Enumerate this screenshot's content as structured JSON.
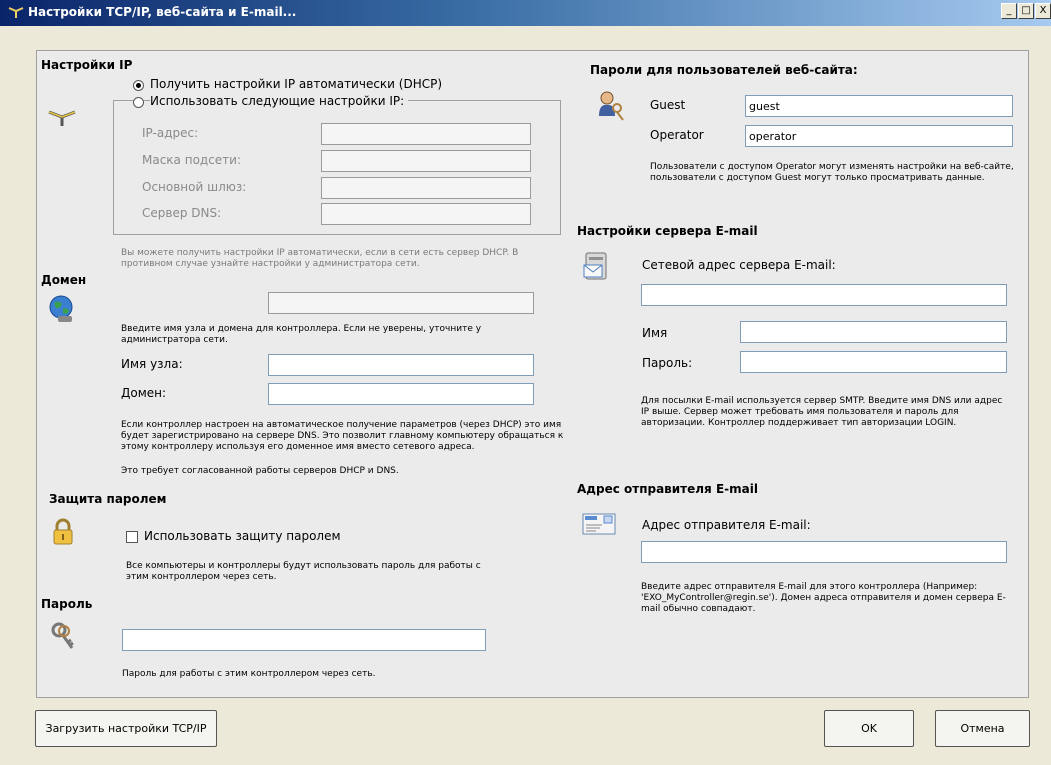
{
  "window": {
    "title": "Настройки TCP/IP, веб-сайта и E-mail...",
    "minimize": "_",
    "maximize": "□",
    "close": "X"
  },
  "ip": {
    "heading": "Настройки IP",
    "dhcp_label": "Получить настройки IP автоматически (DHCP)",
    "static_label": "Использовать следующие настройки IP:",
    "ip_label": "IP-адрес:",
    "mask_label": "Маска подсети:",
    "gateway_label": "Основной шлюз:",
    "dns_label": "Сервер DNS:",
    "ip_value": "",
    "mask_value": "",
    "gateway_value": "",
    "dns_value": "",
    "note": "Вы можете получить настройки IP автоматически, если в сети есть сервер DHCP. В противном случае узнайте настройки у администратора сети."
  },
  "domain": {
    "heading": "Домен",
    "full_value": "",
    "note1": "Введите имя узла и домена для контроллера. Если не уверены, уточните у администратора сети.",
    "host_label": "Имя узла:",
    "host_value": "",
    "domain_label": "Домен:",
    "domain_value": "",
    "note2": "Если контроллер настроен на автоматическое получение параметров (через DHCP) это имя будет зарегистрировано на сервере DNS. Это позволит главному компьютеру обращаться к этому контроллеру используя его доменное имя вместо сетевого адреса.",
    "note3": "Это требует согласованной работы серверов DHCP и DNS."
  },
  "password_protection": {
    "heading": "Защита паролем",
    "checkbox_label": "Использовать защиту паролем",
    "note": "Все компьютеры и контроллеры будут использовать пароль для работы с этим контроллером через сеть."
  },
  "password": {
    "heading": "Пароль",
    "value": "",
    "note": "Пароль для работы с этим контроллером через сеть."
  },
  "web_passwords": {
    "heading": "Пароли для пользователей веб-сайта:",
    "guest_label": "Guest",
    "guest_value": "guest",
    "operator_label": "Operator",
    "operator_value": "operator",
    "note": "Пользователи с доступом Operator могут изменять настройки на веб-сайте, пользователи с доступом Guest могут только просматривать данные."
  },
  "email_server": {
    "heading": "Настройки сервера E-mail",
    "address_label": "Сетевой адрес сервера E-mail:",
    "address_value": "",
    "name_label": "Имя",
    "name_value": "",
    "password_label": "Пароль:",
    "password_value": "",
    "note": "Для посылки E-mail используется сервер SMTP. Введите имя DNS или адрес IP выше. Сервер может требовать имя пользователя и пароль для авторизации. Контроллер поддерживает тип авторизации LOGIN."
  },
  "sender": {
    "heading": "Адрес отправителя E-mail",
    "label": "Адрес отправителя E-mail:",
    "value": "",
    "note": "Введите адрес отправителя E-mail для этого контроллера (Например: 'EXO_MyController@regin.se'). Домен адреса отправителя и домен сервера E-mail обычно совпадают."
  },
  "buttons": {
    "load": "Загрузить настройки TCP/IP",
    "ok": "OK",
    "cancel": "Отмена"
  }
}
